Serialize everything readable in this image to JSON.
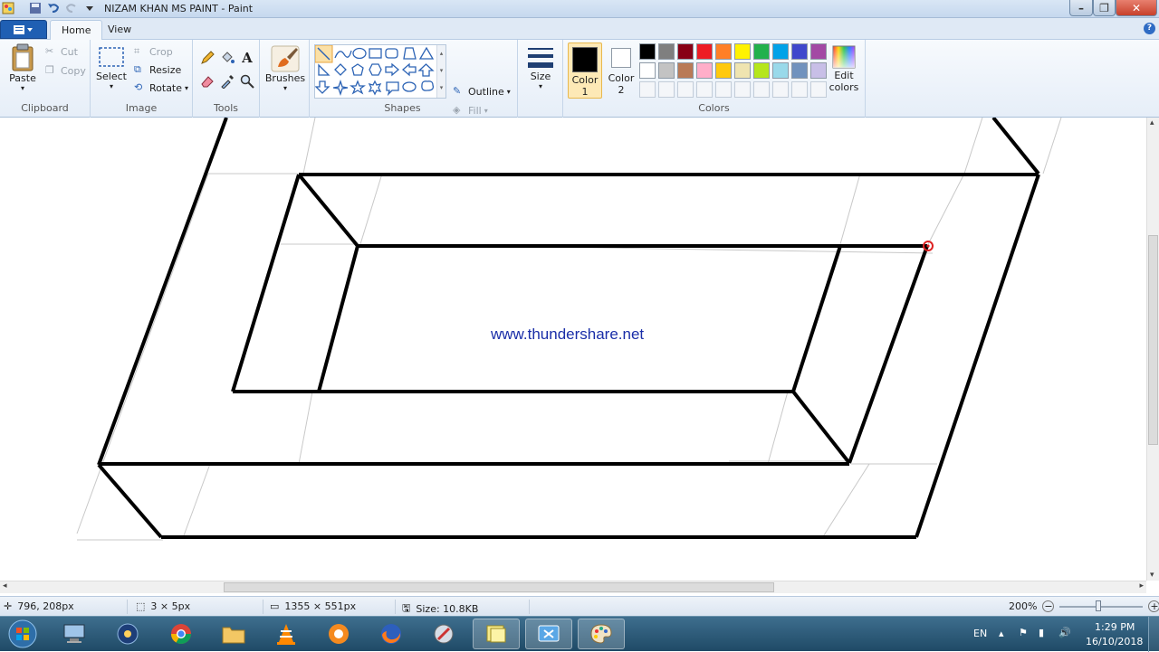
{
  "titlebar": {
    "title": "NIZAM KHAN MS PAINT - Paint"
  },
  "tabs": {
    "home": "Home",
    "view": "View",
    "help": "?"
  },
  "ribbon": {
    "clipboard": {
      "label": "Clipboard",
      "paste": "Paste",
      "cut": "Cut",
      "copy": "Copy"
    },
    "image": {
      "label": "Image",
      "select": "Select",
      "crop": "Crop",
      "resize": "Resize",
      "rotate": "Rotate"
    },
    "tools": {
      "label": "Tools"
    },
    "brushes": {
      "label": "Brushes"
    },
    "shapes": {
      "label": "Shapes",
      "outline": "Outline",
      "fill": "Fill"
    },
    "size": {
      "label": "Size"
    },
    "colors": {
      "label": "Colors",
      "color1": "Color\n1",
      "color1_line1": "Color",
      "color1_line2": "1",
      "color2_line1": "Color",
      "color2_line2": "2",
      "edit_line1": "Edit",
      "edit_line2": "colors",
      "color1_value": "#000000",
      "color2_value": "#ffffff",
      "palette_row1": [
        "#000000",
        "#7f7f7f",
        "#880015",
        "#ed1c24",
        "#ff7f27",
        "#fff200",
        "#22b14c",
        "#00a2e8",
        "#3f48cc",
        "#a349a4"
      ],
      "palette_row2": [
        "#ffffff",
        "#c3c3c3",
        "#b97a57",
        "#ffaec9",
        "#ffc90e",
        "#efe4b0",
        "#b5e61d",
        "#99d9ea",
        "#7092be",
        "#c8bfe7"
      ]
    }
  },
  "canvas": {
    "watermark": "www.thundershare.net"
  },
  "status": {
    "cursor_pos": "796, 208px",
    "selection_size": "3 × 5px",
    "image_size": "1355 × 551px",
    "file_size": "Size: 10.8KB",
    "zoom": "200%"
  },
  "taskbar": {
    "lang": "EN",
    "time": "1:29 PM",
    "date": "16/10/2018"
  }
}
